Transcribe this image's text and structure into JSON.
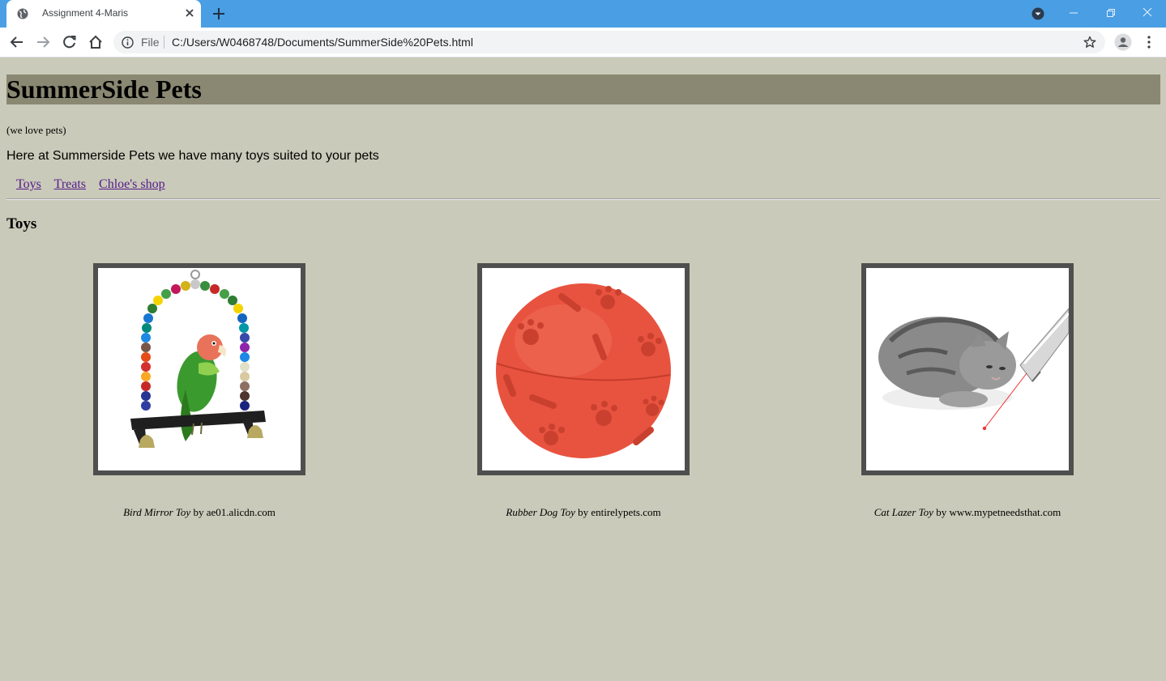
{
  "browser": {
    "tab_title": "Assignment 4-Maris",
    "file_label": "File",
    "url": "C:/Users/W0468748/Documents/SummerSide%20Pets.html"
  },
  "page": {
    "title": "SummerSide Pets",
    "tagline": "(we love pets)",
    "intro": "Here at Summerside Pets we have many toys suited to your pets",
    "nav": [
      {
        "label": "Toys"
      },
      {
        "label": "Treats"
      },
      {
        "label": "Chloe's shop"
      }
    ],
    "section_title": "Toys",
    "products": [
      {
        "name": "Bird Mirror Toy",
        "by": "by",
        "source": "ae01.alicdn.com"
      },
      {
        "name": "Rubber Dog Toy",
        "by": "by",
        "source": "entirelypets.com"
      },
      {
        "name": "Cat Lazer Toy",
        "by": "by",
        "source": "www.mypetneedsthat.com"
      }
    ]
  },
  "colors": {
    "tabbar": "#4a9ee3",
    "page_bg": "#c9cab9",
    "heading_bg": "#8a8872",
    "link": "#551a8b",
    "image_border": "#4f4f4f"
  }
}
